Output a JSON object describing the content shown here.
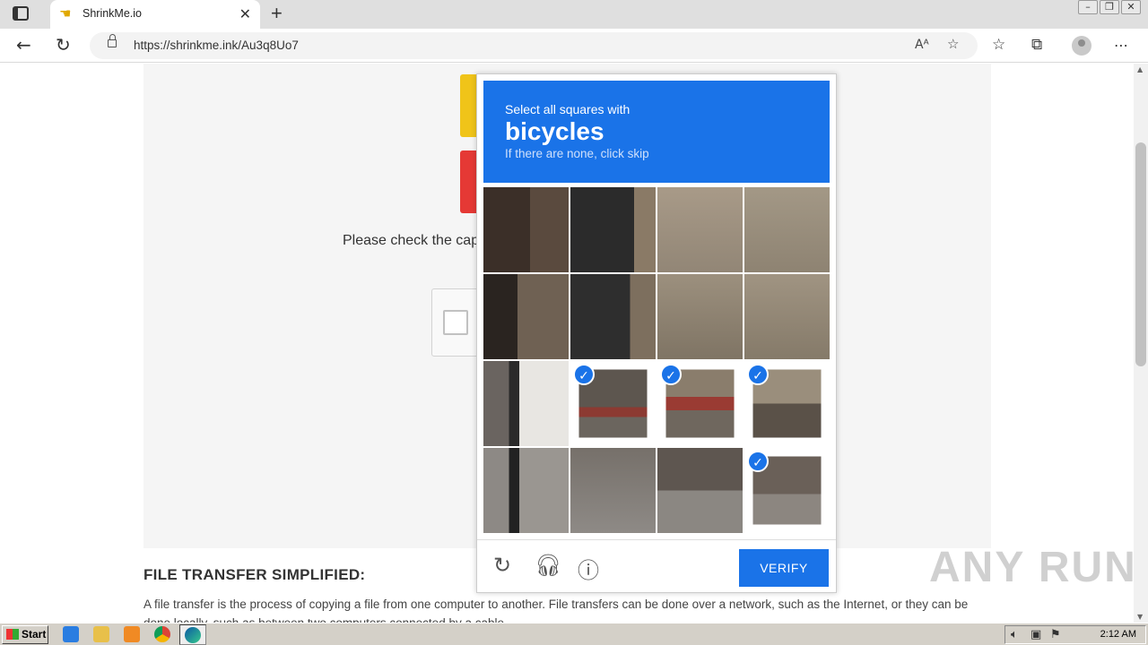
{
  "browser": {
    "tab_title": "ShrinkMe.io",
    "url": "https://shrinkme.ink/Au3q8Uo7"
  },
  "page": {
    "instruction": "Please check the captcha box to proceed to the destination page.",
    "section_title": "FILE TRANSFER SIMPLIFIED:",
    "section_text": "A file transfer is the process of copying a file from one computer to another. File transfers can be done over a network, such as the Internet, or they can be done locally, such as between two computers connected by a cable."
  },
  "captcha": {
    "prompt": "Select all squares with",
    "target": "bicycles",
    "hint": "If there are none, click skip",
    "verify_label": "VERIFY",
    "selected_tiles": [
      9,
      10,
      11,
      15
    ]
  },
  "watermark": "ANY RUN",
  "taskbar": {
    "start_label": "Start",
    "clock": "2:12 AM"
  },
  "colors": {
    "accent": "#1a73e8"
  }
}
